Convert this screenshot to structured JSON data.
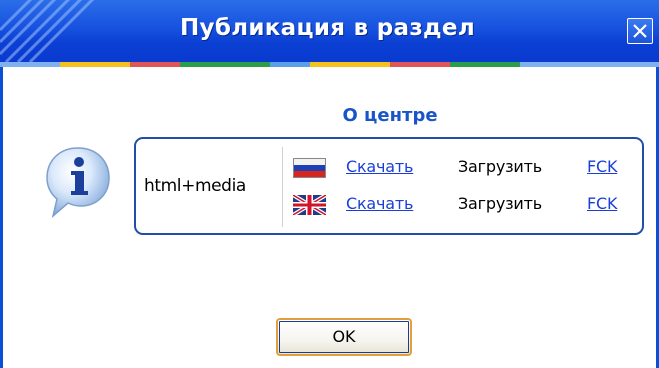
{
  "window": {
    "title": "Публикация в раздел",
    "close_icon": "close-icon"
  },
  "content": {
    "heading": "О центре",
    "info_icon": "info-icon",
    "format_label": "html+media",
    "rows": [
      {
        "flag_icon": "russian-flag-icon",
        "download_label": "Скачать",
        "upload_label": "Загрузить",
        "fck_label": "FCK"
      },
      {
        "flag_icon": "uk-flag-icon",
        "download_label": "Скачать",
        "upload_label": "Загрузить",
        "fck_label": "FCK"
      }
    ]
  },
  "buttons": {
    "ok_label": "OK"
  },
  "colors": {
    "titlebar": "#0b3fd2",
    "heading": "#1a55c8",
    "link": "#1a3fd8",
    "box_border": "#1f4fa6",
    "ok_border": "#e3a03a"
  }
}
